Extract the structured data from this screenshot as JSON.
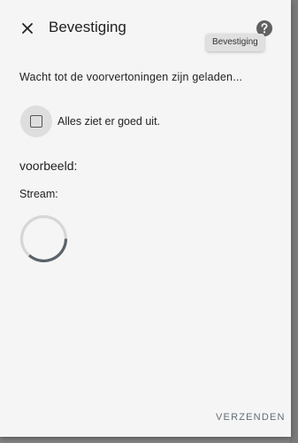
{
  "dialog": {
    "title": "Bevestiging",
    "help_tooltip": "Bevestiging",
    "close_icon": "close-icon",
    "help_icon": "help-circle-icon"
  },
  "content": {
    "wait_message": "Wacht tot de voorvertoningen zijn geladen...",
    "checkbox": {
      "label": "Alles ziet er goed uit.",
      "checked": false
    },
    "preview_heading": "voorbeeld:",
    "stream_label": "Stream:",
    "loading_icon": "loading-spinner-icon"
  },
  "actions": {
    "submit_label": "VERZENDEN"
  },
  "colors": {
    "accent": "#5f6e78",
    "spinner_track": "#d6d6d6",
    "spinner_arc": "#5a626a",
    "dialog_bg": "#f5f5f5"
  }
}
